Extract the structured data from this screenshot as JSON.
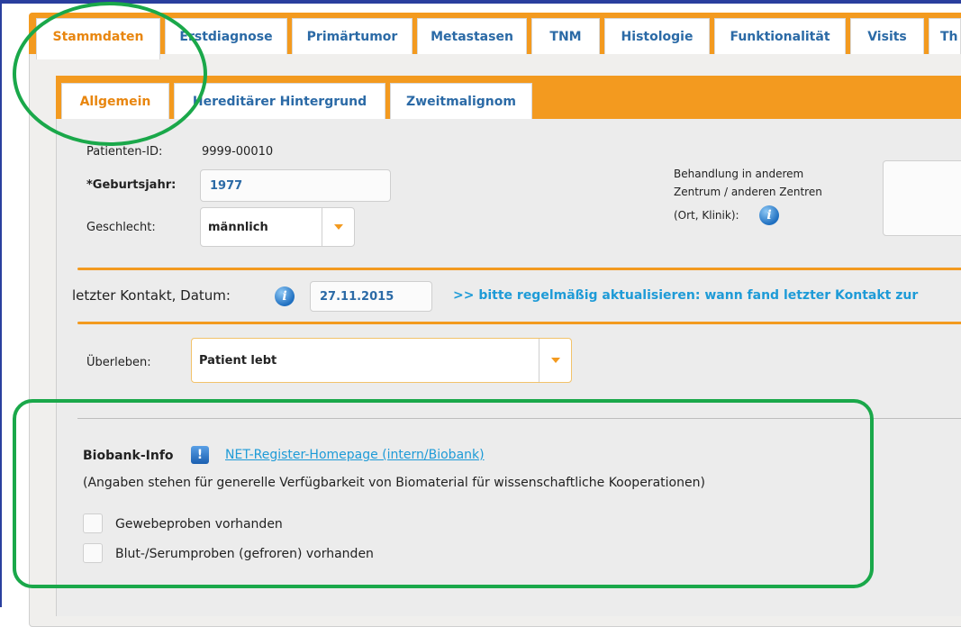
{
  "main_tabs": [
    {
      "label": "Stammdaten"
    },
    {
      "label": "Erstdiagnose"
    },
    {
      "label": "Primärtumor"
    },
    {
      "label": "Metastasen"
    },
    {
      "label": "TNM"
    },
    {
      "label": "Histologie"
    },
    {
      "label": "Funktionalität"
    },
    {
      "label": "Visits"
    },
    {
      "label": "Th"
    }
  ],
  "sub_tabs": [
    {
      "label": "Allgemein"
    },
    {
      "label": "Hereditärer Hintergrund"
    },
    {
      "label": "Zweitmalignom"
    }
  ],
  "patient": {
    "id_label": "Patienten-ID:",
    "id_value": "9999-00010",
    "birthyear_label": "*Geburtsjahr:",
    "birthyear_value": "1977",
    "sex_label": "Geschlecht:",
    "sex_value": "männlich",
    "other_center_label_1": "Behandlung in anderem",
    "other_center_label_2": "Zentrum / anderen Zentren",
    "other_center_label_3": "(Ort, Klinik):"
  },
  "contact": {
    "label": "letzter Kontakt, Datum:",
    "date_value": "27.11.2015",
    "hint": ">> bitte regelmäßig aktualisieren: wann fand letzter Kontakt zur"
  },
  "survival": {
    "label": "Überleben:",
    "value": "Patient lebt"
  },
  "biobank": {
    "title": "Biobank-Info",
    "link": "NET-Register-Homepage (intern/Biobank)",
    "description": "(Angaben stehen für generelle Verfügbarkeit von Biomaterial für wissenschaftliche Kooperationen)",
    "tissue_label": "Gewebeproben vorhanden",
    "blood_label": "Blut-/Serumproben (gefroren) vorhanden"
  },
  "colors": {
    "accent": "#f39a1f",
    "active_tab_text": "#e8860f",
    "tab_text": "#2b6aa6",
    "link": "#1e9bd7",
    "annotation": "#1aa84a"
  }
}
